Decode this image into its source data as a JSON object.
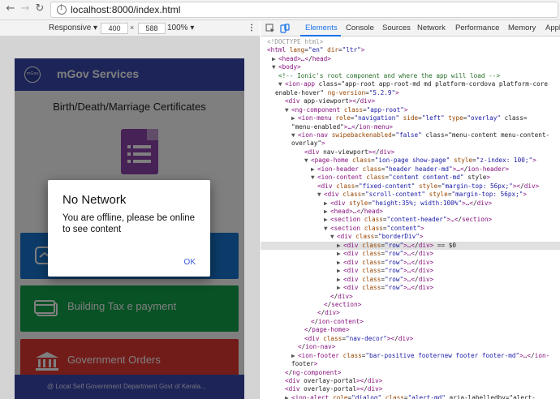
{
  "browser": {
    "url": "localhost:8000/index.html"
  },
  "device_toolbar": {
    "device": "Responsive",
    "width": "400",
    "times": "×",
    "height": "588",
    "zoom": "100%"
  },
  "app": {
    "header_title": "mGov Services",
    "logo_text": "mGov",
    "page_title": "Birth/Death/Marriage Certificates",
    "cards": [
      {
        "label": "",
        "color": "#1976d2"
      },
      {
        "label": "Building Tax e payment",
        "color": "#10a54a"
      },
      {
        "label": "Government Orders",
        "color": "#e53935"
      }
    ],
    "footer": "@ Local Self Government Department Govt of Kerala..."
  },
  "dialog": {
    "title": "No Network",
    "message": "You are offline, please be online to see content",
    "ok": "OK"
  },
  "devtools": {
    "tabs": [
      "Elements",
      "Console",
      "Sources",
      "Network",
      "Performance",
      "Memory",
      "Appl"
    ],
    "active_tab": "Elements",
    "lines": [
      {
        "t": "<!DOCTYPE html>"
      },
      {
        "t": "<html lang=\"en\" dir=\"ltr\">"
      },
      {
        "t": "▶ <head>…</head>"
      },
      {
        "t": "▼ <body>"
      },
      {
        "t": "<!-- Ionic's root component and where the app will load -->"
      },
      {
        "t": "▼ <ion-app class=\"app-root app-root-md md platform-cordova platform-core"
      },
      {
        "t": "enable-hover\" ng-version=\"5.2.9\">"
      },
      {
        "t": "<div app-viewport></div>"
      },
      {
        "t": "▼ <ng-component class=\"app-root\">"
      },
      {
        "t": "▶ <ion-menu role=\"navigation\" side=\"left\" type=\"overlay\" class="
      },
      {
        "t": "\"menu-enabled\">…</ion-menu>"
      },
      {
        "t": "▼ <ion-nav swipebackenabled=\"false\" class=\"menu-content menu-content-"
      },
      {
        "t": "overlay\">"
      },
      {
        "t": "<div nav-viewport></div>"
      },
      {
        "t": "▼ <page-home class=\"ion-page show-page\" style=\"z-index: 100;\">"
      },
      {
        "t": "▶ <ion-header class=\"header header-md\">…</ion-header>"
      },
      {
        "t": "▼ <ion-content class=\"content content-md\" style>"
      },
      {
        "t": "<div class=\"fixed-content\" style=\"margin-top: 56px;\"></div>"
      },
      {
        "t": "▼ <div class=\"scroll-content\" style=\"margin-top: 56px;\">"
      },
      {
        "t": "▶ <div style=\"height:35%; width:100%\">…</div>"
      },
      {
        "t": "▶ <head>…</head>"
      },
      {
        "t": "▶ <section class=\"content-header\">…</section>"
      },
      {
        "t": "▼ <section class=\"content\">"
      },
      {
        "t": "▼ <div class=\"borderDiv\">"
      },
      {
        "t": "▶ <div class=\"row\">…</div> == $0"
      },
      {
        "t": "▶ <div class=\"row\">…</div>"
      },
      {
        "t": "▶ <div class=\"row\">…</div>"
      },
      {
        "t": "▶ <div class=\"row\">…</div>"
      },
      {
        "t": "▶ <div class=\"row\">…</div>"
      },
      {
        "t": "▶ <div class=\"row\">…</div>"
      },
      {
        "t": "</div>"
      },
      {
        "t": "</section>"
      },
      {
        "t": "</div>"
      },
      {
        "t": "</ion-content>"
      },
      {
        "t": "</page-home>"
      },
      {
        "t": "<div class=\"nav-decor\"></div>"
      },
      {
        "t": "</ion-nav>"
      },
      {
        "t": "▶ <ion-footer class=\"bar-positive footernew footer footer-md\">…</ion-"
      },
      {
        "t": "footer>"
      },
      {
        "t": "</ng-component>"
      },
      {
        "t": "<div overlay-portal></div>"
      },
      {
        "t": "<div overlay-portal></div>"
      },
      {
        "t": "▶ <ion-alert role=\"dialog\" class=\"alert-md\" aria-labelledby=\"alert-"
      }
    ]
  }
}
